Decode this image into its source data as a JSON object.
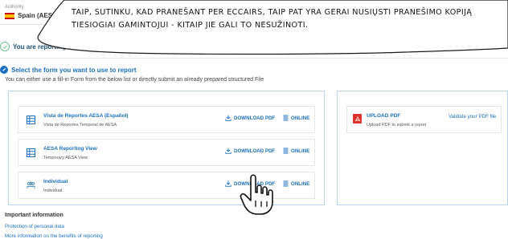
{
  "authority": {
    "label": "Authority",
    "value": "Spain (AES"
  },
  "reporting_status": "You are reporting on yo",
  "form_section": {
    "title": "Select the form you want to use to report",
    "description": "You can either use a fill-in Form from the below list or directly submit an already prepared structured File"
  },
  "forms": [
    {
      "name": "Vista de Reportes AESA (Español)",
      "subtitle": "Vista de Reportes Temporal de AESA",
      "icon": "form-grid-icon",
      "download_label": "DOWNLOAD PDF",
      "online_label": "ONLINE"
    },
    {
      "name": "AESA Reporting View",
      "subtitle": "Temporary AESA View",
      "icon": "form-grid-icon",
      "download_label": "DOWNLOAD PDF",
      "online_label": "ONLINE"
    },
    {
      "name": "Individual",
      "subtitle": "Individual",
      "icon": "people-icon",
      "download_label": "DOWNLOAD PDF",
      "online_label": "ONLINE"
    }
  ],
  "upload": {
    "title": "UPLOAD PDF",
    "subtitle": "Upload PDF to submit a report",
    "validate_label": "Validate your PDF file",
    "icon": "pdf-icon"
  },
  "important_info": {
    "title": "Important information",
    "links": [
      "Protection of personal data",
      "More information on the benefits of reporting"
    ]
  },
  "speech_bubble": {
    "text": "TAIP, SUTINKU, KAD PRANEŠANT PER ECCAIRS, TAIP PAT YRA GERAI NUSIŲSTI PRANEŠIMO KOPIJĄ TIESIOGIAI GAMINTOJUI - KITAIP JIE GALI TO NESUŽINOTI."
  },
  "colors": {
    "accent": "#1b6fc3",
    "panel_border": "#b8d3f0",
    "success": "#6cc08b",
    "pdf_red": "#e0322c"
  }
}
